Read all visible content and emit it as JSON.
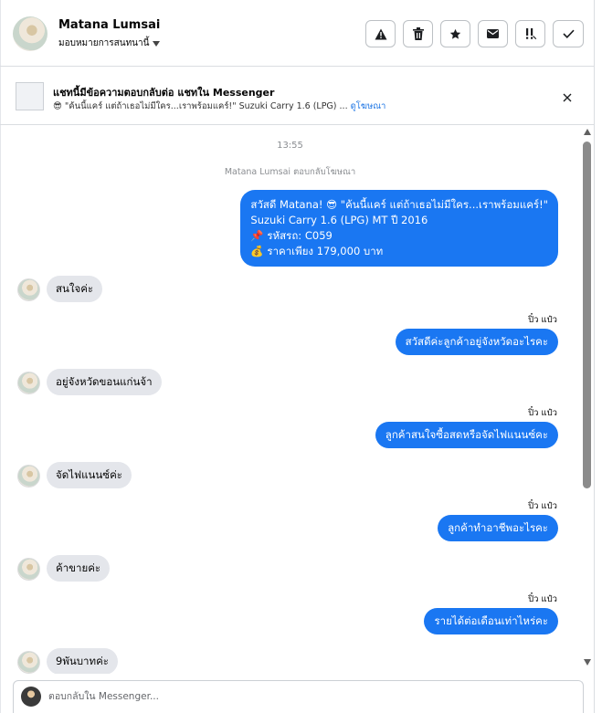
{
  "header": {
    "name": "Matana Lumsai",
    "assign_label": "มอบหมายการสนทนานี้",
    "actions": [
      "warning-icon",
      "trash-icon",
      "star-icon",
      "envelope-icon",
      "important-icon",
      "check-icon"
    ]
  },
  "banner": {
    "title": "แชทนี้มีข้อความตอบกลับต่อ แชทใน Messenger",
    "subtitle": "😎 \"ค้นนี้แคร์ แต่ถ้าเธอไม่มีใคร...เราพร้อมแคร์!\" Suzuki Carry 1.6 (LPG) ...",
    "link": "ดูโฆษณา"
  },
  "chat": {
    "time": "13:55",
    "system": "Matana Lumsai ตอบกลับโฆษณา",
    "first_out": {
      "line1": "สวัสดี Matana! 😎 \"ค้นนี้แคร์ แต่ถ้าเธอไม่มีใคร...เราพร้อมแคร์!\"",
      "line2": "Suzuki Carry 1.6 (LPG) MT ปี 2016",
      "line3": "📌 รหัสรถ: C059",
      "line4": "💰 ราคาเพียง 179,000 บาท"
    },
    "messages": [
      {
        "in": "สนใจค่ะ",
        "sender": "ปิ๋ว แป๋ว",
        "out": "สวัสดีค่ะลูกค้าอยู่จังหวัดอะไรคะ"
      },
      {
        "in": "อยู่จังหวัดขอนแก่นจ้า",
        "sender": "ปิ๋ว แป๋ว",
        "out": "ลูกค้าสนใจซื้อสดหรือจัดไฟแนนซ์คะ"
      },
      {
        "in": "จัดไฟแนนซ์ค่ะ",
        "sender": "ปิ๋ว แป๋ว",
        "out": "ลูกค้าทำอาชีพอะไรคะ"
      },
      {
        "in": "ค้าขายค่ะ",
        "sender": "ปิ๋ว แป๋ว",
        "out": "รายได้ต่อเดือนเท่าไหร่คะ"
      },
      {
        "in": "9พันบาทค่ะ"
      }
    ]
  },
  "composer": {
    "placeholder": "ตอบกลับใน Messenger..."
  }
}
